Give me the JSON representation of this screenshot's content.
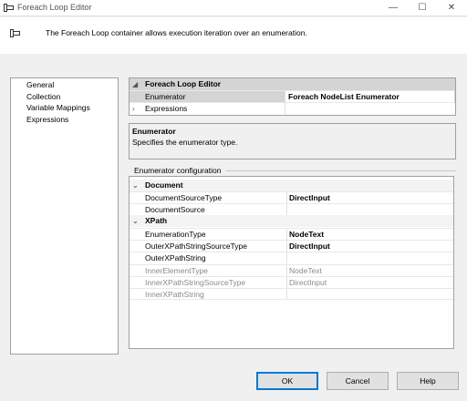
{
  "window": {
    "title": "Foreach Loop Editor",
    "controls": {
      "minimize": "—",
      "maximize": "☐",
      "close": "✕"
    }
  },
  "header": {
    "description": "The Foreach Loop container allows execution iteration over an enumeration."
  },
  "nav": {
    "items": [
      {
        "label": "General"
      },
      {
        "label": "Collection"
      },
      {
        "label": "Variable Mappings"
      },
      {
        "label": "Expressions"
      }
    ]
  },
  "top_grid": {
    "category": "Foreach Loop Editor",
    "rows": [
      {
        "name": "Enumerator",
        "value": "Foreach NodeList Enumerator"
      },
      {
        "name": "Expressions",
        "value": ""
      }
    ]
  },
  "help": {
    "title": "Enumerator",
    "description": "Specifies the enumerator type."
  },
  "enum_config": {
    "group_label": "Enumerator configuration",
    "categories": [
      {
        "name": "Document",
        "rows": [
          {
            "name": "DocumentSourceType",
            "value": "DirectInput"
          },
          {
            "name": "DocumentSource",
            "value": ""
          }
        ]
      },
      {
        "name": "XPath",
        "rows": [
          {
            "name": "EnumerationType",
            "value": "NodeText"
          },
          {
            "name": "OuterXPathStringSourceType",
            "value": "DirectInput"
          },
          {
            "name": "OuterXPathString",
            "value": ""
          },
          {
            "name": "InnerElementType",
            "value": "NodeText"
          },
          {
            "name": "InnerXPathStringSourceType",
            "value": "DirectInput"
          },
          {
            "name": "InnerXPathString",
            "value": ""
          }
        ]
      }
    ]
  },
  "buttons": {
    "ok": "OK",
    "cancel": "Cancel",
    "help": "Help"
  },
  "colors": {
    "accent": "#0078d7",
    "category_bg": "#d4d4d4",
    "border": "#a0a0a0"
  },
  "icons": {
    "app": "container-icon",
    "header": "container-icon"
  }
}
